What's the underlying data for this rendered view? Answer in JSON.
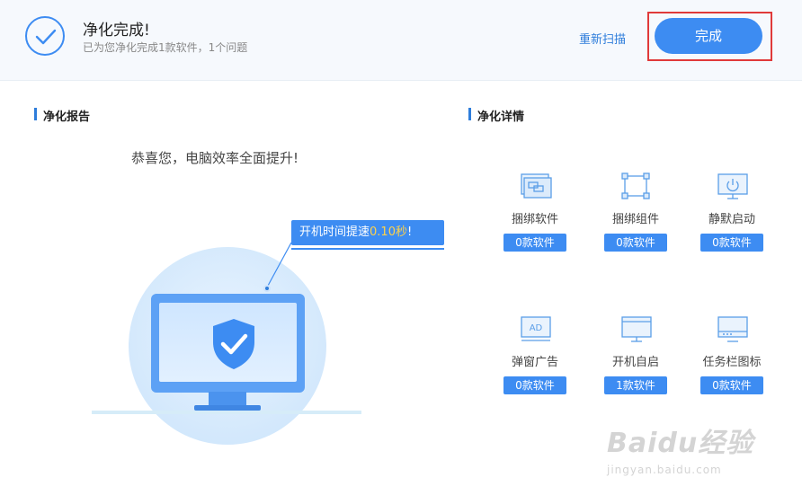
{
  "header": {
    "title": "净化完成!",
    "subtitle": "已为您净化完成1款软件，1个问题",
    "rescan_label": "重新扫描",
    "done_label": "完成"
  },
  "report": {
    "section_title": "净化报告",
    "congrats": "恭喜您，电脑效率全面提升!",
    "boot_prefix": "开机时间提速",
    "boot_value": "0.10秒",
    "boot_suffix": "!"
  },
  "details": {
    "section_title": "净化详情",
    "items": [
      {
        "label": "捆绑软件",
        "count": "0款软件",
        "icon": "bundled-software-icon"
      },
      {
        "label": "捆绑组件",
        "count": "0款软件",
        "icon": "bundled-component-icon"
      },
      {
        "label": "静默启动",
        "count": "0款软件",
        "icon": "silent-startup-icon"
      },
      {
        "label": "弹窗广告",
        "count": "0款软件",
        "icon": "popup-ad-icon"
      },
      {
        "label": "开机自启",
        "count": "1款软件",
        "icon": "boot-autostart-icon"
      },
      {
        "label": "任务栏图标",
        "count": "0款软件",
        "icon": "taskbar-icon"
      }
    ]
  },
  "icons": {
    "popup_ad_text": "AD"
  },
  "watermark": {
    "brand": "Baidu经验",
    "url": "jingyan.baidu.com"
  },
  "colors": {
    "accent": "#3d8cf2",
    "highlight": "#ffd24a",
    "frame": "#e03a3a"
  }
}
